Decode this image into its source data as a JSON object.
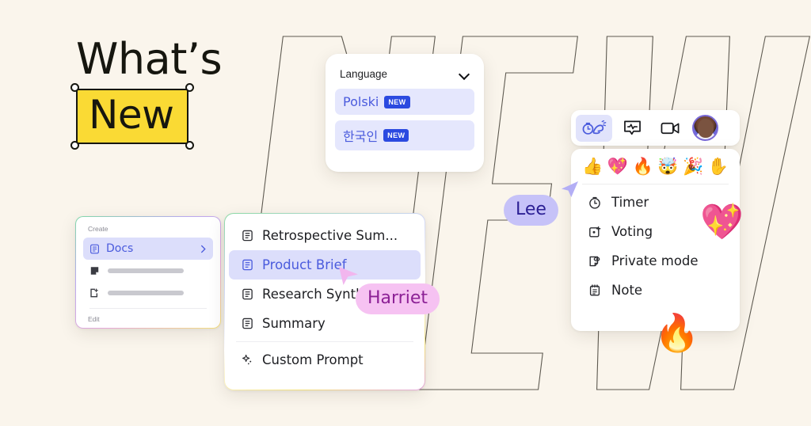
{
  "page": {
    "background_color": "#faf5ec",
    "headline_line1": "What’s",
    "headline_line2": "New",
    "highlight_color": "#fada34"
  },
  "background_text": "NEW",
  "language_card": {
    "header_label": "Language",
    "chevron_icon": "chevron-down-icon",
    "badge_label": "NEW",
    "options": [
      {
        "name": "Polski",
        "badge": "NEW"
      },
      {
        "name": "한국인",
        "badge": "NEW"
      }
    ]
  },
  "create_card": {
    "section_label": "Create",
    "selected_item": "Docs",
    "selected_icon": "document-icon",
    "chevron_icon": "chevron-right-icon",
    "placeholder_rows": [
      {
        "icon": "sticky-note-icon"
      },
      {
        "icon": "open-board-icon"
      }
    ],
    "footer_label": "Edit"
  },
  "templates_card": {
    "items": [
      {
        "label": "Retrospective Sum...",
        "icon": "document-icon",
        "selected": false
      },
      {
        "label": "Product Brief",
        "icon": "document-icon",
        "selected": true
      },
      {
        "label": "Research Synthe",
        "icon": "document-icon",
        "selected": false
      },
      {
        "label": "Summary",
        "icon": "document-icon",
        "selected": false
      }
    ],
    "custom_item": {
      "label": "Custom Prompt",
      "icon": "sparkle-icon"
    }
  },
  "toolbar": {
    "buttons": [
      {
        "name": "reactions-timer-icon",
        "active": true
      },
      {
        "name": "chat-icon",
        "active": false
      },
      {
        "name": "video-camera-icon",
        "active": false
      }
    ],
    "avatar": "user-avatar"
  },
  "tools_card": {
    "emojis": [
      {
        "name": "thumbs-up-emoji",
        "glyph": "👍"
      },
      {
        "name": "sparkling-heart-emoji",
        "glyph": "💖"
      },
      {
        "name": "fire-emoji",
        "glyph": "🔥"
      },
      {
        "name": "mind-blown-emoji",
        "glyph": "🤯"
      },
      {
        "name": "party-popper-emoji",
        "glyph": "🎉"
      },
      {
        "name": "raised-hand-emoji",
        "glyph": "✋"
      }
    ],
    "items": [
      {
        "label": "Timer",
        "icon": "timer-icon"
      },
      {
        "label": "Voting",
        "icon": "voting-icon"
      },
      {
        "label": "Private mode",
        "icon": "private-mode-icon"
      },
      {
        "label": "Note",
        "icon": "note-icon"
      }
    ]
  },
  "cursors": [
    {
      "name": "Lee",
      "pill_color": "#c6c2f8",
      "text_color": "#2b1f94",
      "arrow_color": "#b3aef5"
    },
    {
      "name": "Harriet",
      "pill_color": "#f6c2f2",
      "text_color": "#8d2196",
      "arrow_color": "#f2b6ee"
    }
  ],
  "stickers": [
    {
      "name": "heart-sticker",
      "glyph": "💖"
    },
    {
      "name": "fire-sticker",
      "glyph": "🔥"
    }
  ]
}
